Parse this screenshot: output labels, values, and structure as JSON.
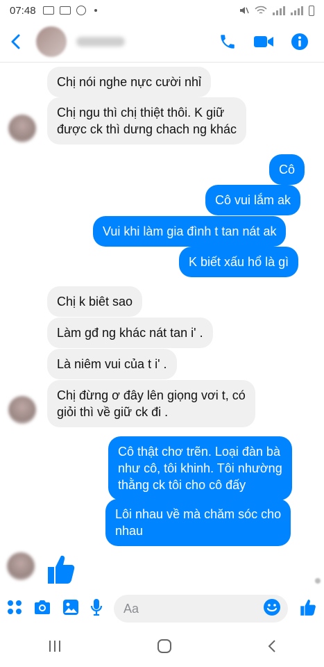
{
  "status": {
    "time": "07:48"
  },
  "composer": {
    "placeholder": "Aa"
  },
  "messages": [
    {
      "side": "in",
      "text": "Chị nói nghe nực cười nhỉ"
    },
    {
      "side": "in",
      "text": "Chị ngu thì chị thiệt thôi.  K giữ\nđược ck thì dưng chach ng khác"
    },
    {
      "side": "out",
      "text": "Cô"
    },
    {
      "side": "out",
      "text": "Cô vui lắm ak"
    },
    {
      "side": "out",
      "text": "Vui khi làm  gia đình t tan nát ak"
    },
    {
      "side": "out",
      "text": "K biết xấu hổ là gì"
    },
    {
      "side": "in",
      "text": "Chị k biêt sao"
    },
    {
      "side": "in",
      "text": "Làm gđ ng khác nát tan i' ."
    },
    {
      "side": "in",
      "text": "Là niêm vui của t i' ."
    },
    {
      "side": "in",
      "text": "Chị đừng ơ đây lên giọng vơi t, có\ngiỏi thì về giữ ck đi ."
    },
    {
      "side": "out",
      "text": "Cô thật chơ trẽn.  Loại đàn bà\nnhư cô,  tôi khinh. Tôi nhường\nthằng ck tôi cho cô đấy"
    },
    {
      "side": "out",
      "text": "Lôi nhau về mà chăm sóc cho\nnhau"
    }
  ],
  "icons": [
    "back-icon",
    "phone-icon",
    "video-icon",
    "info-icon",
    "apps-icon",
    "camera-icon",
    "gallery-icon",
    "microphone-icon",
    "emoji-icon",
    "like-icon"
  ],
  "colors": {
    "accent": "#0084ff",
    "incoming_bubble": "#f1f0f0"
  }
}
